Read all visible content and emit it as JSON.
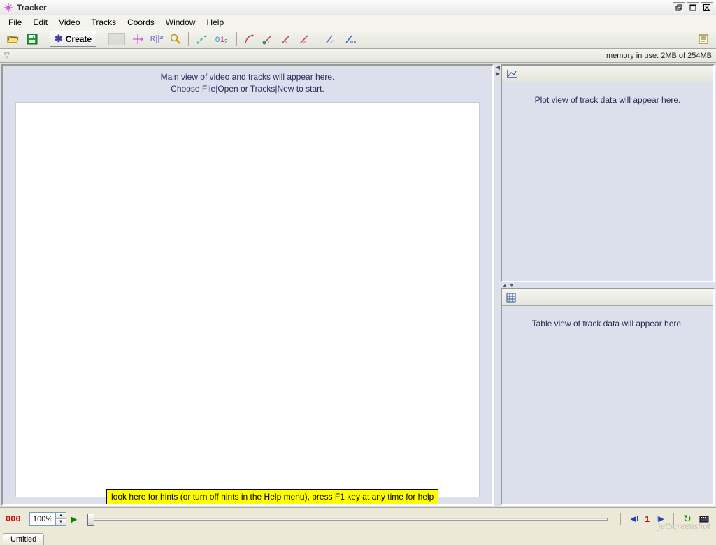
{
  "app": {
    "title": "Tracker"
  },
  "menubar": [
    "File",
    "Edit",
    "Video",
    "Tracks",
    "Coords",
    "Window",
    "Help"
  ],
  "toolbar": {
    "create_label": "Create"
  },
  "statusbar": {
    "memory": "memory in use: 2MB of 254MB"
  },
  "main_view": {
    "hint_line1": "Main view of video and tracks will appear here.",
    "hint_line2": "Choose File|Open or Tracks|New to start."
  },
  "hints_bar": "look here for hints (or turn off hints in the Help menu), press F1 key at any time for help",
  "plot_panel": {
    "hint": "Plot view of track data will appear here."
  },
  "table_panel": {
    "hint": "Table view of track data will appear here."
  },
  "playback": {
    "frame": "000",
    "zoom": "100%",
    "step": "1"
  },
  "tabs": [
    "Untitled"
  ],
  "watermark": "jetScreenshot"
}
